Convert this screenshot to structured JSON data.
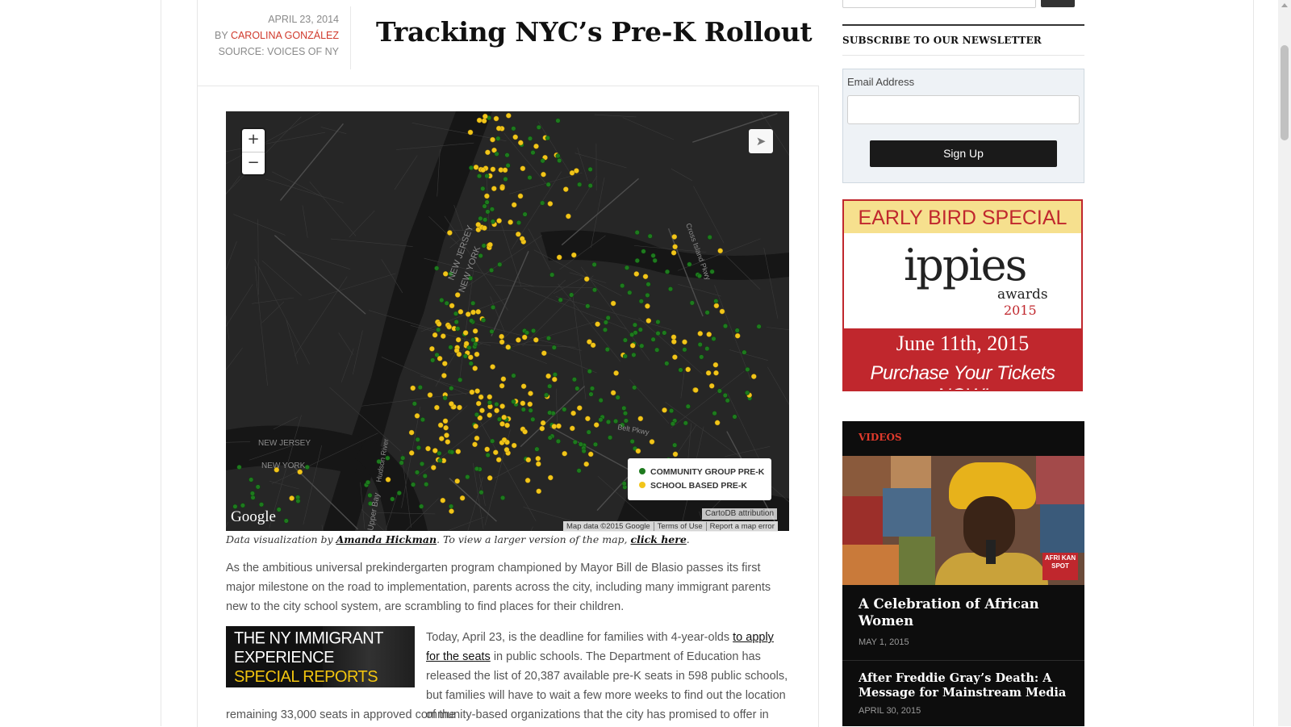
{
  "article": {
    "date": "APRIL 23, 2014",
    "by_prefix": "BY ",
    "author": "CAROLINA GONZÁLEZ",
    "source": "SOURCE: VOICES OF NY",
    "title": "Tracking NYC’s Pre-K Rollout"
  },
  "map": {
    "zoom_in": "+",
    "zoom_out": "−",
    "share_icon": "paper-plane-icon",
    "labels": [
      "NEW JERSEY",
      "NEW YORK",
      "NEW JERSEY",
      "NEW YORK",
      "Upper Bay",
      "Hudson River",
      "Cross Island Pkwy",
      "Belt Pkwy"
    ],
    "legend": [
      {
        "label": "COMMUNITY GROUP PRE-K",
        "color": "#1e7a1e"
      },
      {
        "label": "SCHOOL BASED PRE-K",
        "color": "#f2c51a"
      }
    ],
    "google_logo": "Google",
    "cartodb": "CartoDB attribution",
    "map_data": "Map data ©2015 Google",
    "terms": "Terms of Use",
    "report": "Report a map error"
  },
  "caption": {
    "prefix": "Data visualization by ",
    "author_link": "Amanda Hickman",
    "middle": ". To view a larger version of the map, ",
    "click_link": "click here",
    "suffix": "."
  },
  "body": {
    "p1": "As the ambitious universal prekindergarten program championed by Mayor Bill de Blasio passes its first major milestone on the road to implementation, parents across the city, including many immigrant parents new to the city school system, are scrambling to find places for their children.",
    "p2_start": "Today, April 23, is the deadline for families with 4-year-olds ",
    "p2_link": "to apply for the seats",
    "p2_end": " in public schools. The Department of Education has released the list of 20,387 available pre-K seats in 598 public schools, but families will have to wait a few more weeks to find out the location of the",
    "p3": "remaining 33,000 seats in approved community-based organizations that the city has promised to offer in",
    "banner": {
      "line1": "THE NY IMMIGRANT",
      "line2": "EXPERIENCE",
      "line3": "SPECIAL REPORTS"
    }
  },
  "sidebar": {
    "newsletter_title": "SUBSCRIBE TO OUR NEWSLETTER",
    "email_label": "Email Address",
    "signup_label": "Sign Up",
    "ad": {
      "top": "EARLY BIRD SPECIAL",
      "logo": "ippies",
      "awards": "awards",
      "year": "2015",
      "date": "June 11th, 2015",
      "cta": "Purchase Your Tickets NOW!"
    },
    "videos": {
      "title": "VIDEOS",
      "badge": "AFRI KAN SPOT",
      "items": [
        {
          "title": "A Celebration of African Women",
          "date": "MAY 1, 2015"
        },
        {
          "title": "After Freddie Gray’s Death: A Message for Mainstream Media",
          "date": "APRIL 30, 2015"
        }
      ]
    }
  },
  "colors": {
    "accent_red": "#d0392b",
    "community": "#1e7a1e",
    "school": "#f2c51a"
  }
}
